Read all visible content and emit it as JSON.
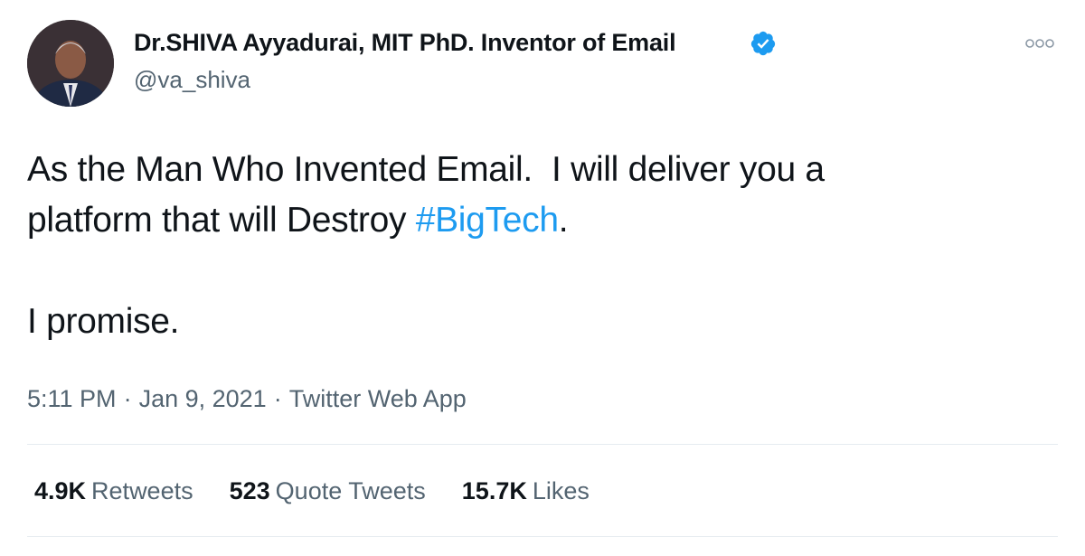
{
  "author": {
    "display_name": "Dr.SHIVA Ayyadurai, MIT PhD. Inventor of Email",
    "handle": "@va_shiva",
    "verified": true
  },
  "tweet": {
    "text_line1": "As the Man Who Invented Email.  I will deliver you a",
    "text_line2_prefix": "platform that will Destroy ",
    "hashtag": "#BigTech",
    "text_line2_suffix": ".",
    "text_line3": "I promise."
  },
  "meta": {
    "time": "5:11 PM",
    "separator": "·",
    "date": "Jan 9, 2021",
    "source": "Twitter Web App"
  },
  "stats": {
    "retweets_count": "4.9K",
    "retweets_label": "Retweets",
    "quotes_count": "523",
    "quotes_label": "Quote Tweets",
    "likes_count": "15.7K",
    "likes_label": "Likes"
  },
  "colors": {
    "accent": "#1d9bf0",
    "secondary_text": "#536471",
    "divider": "#e6ecf0"
  },
  "icons": {
    "verified": "verified-badge-icon",
    "more": "more-options-icon"
  }
}
